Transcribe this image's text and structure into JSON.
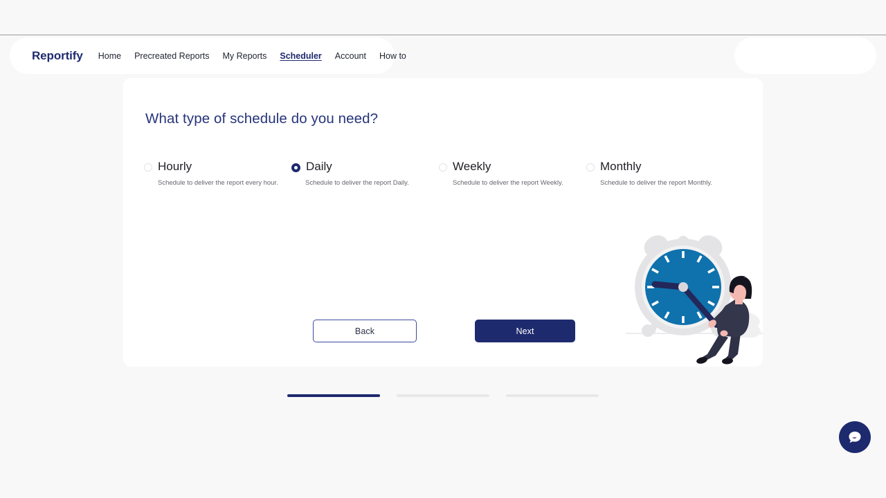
{
  "navbar": {
    "brand": "Reportify",
    "links": [
      {
        "label": "Home",
        "active": false
      },
      {
        "label": "Precreated Reports",
        "active": false
      },
      {
        "label": "My Reports",
        "active": false
      },
      {
        "label": "Scheduler",
        "active": true
      },
      {
        "label": "Account",
        "active": false
      },
      {
        "label": "How to",
        "active": false
      }
    ]
  },
  "card": {
    "title": "What type of schedule do you need?",
    "options": [
      {
        "label": "Hourly",
        "description": "Schedule to deliver the report every hour.",
        "selected": false
      },
      {
        "label": "Daily",
        "description": "Schedule to deliver the report Daily.",
        "selected": true
      },
      {
        "label": "Weekly",
        "description": "Schedule to deliver the report Weekly.",
        "selected": false
      },
      {
        "label": "Monthly",
        "description": "Schedule to deliver the report Monthly.",
        "selected": false
      }
    ],
    "buttons": {
      "back": "Back",
      "next": "Next"
    }
  },
  "progress": {
    "steps": [
      {
        "active": true
      },
      {
        "active": false
      },
      {
        "active": false
      }
    ]
  },
  "colors": {
    "brand_navy": "#1e2a6e",
    "title_blue": "#26347a",
    "clock_blue": "#0f72ac",
    "page_background": "#f8f8f8",
    "card_background": "#ffffff",
    "step_inactive": "#e8e8ea",
    "muted_text": "#65676d"
  },
  "icons": {
    "chat": "chat-bubble-icon"
  }
}
